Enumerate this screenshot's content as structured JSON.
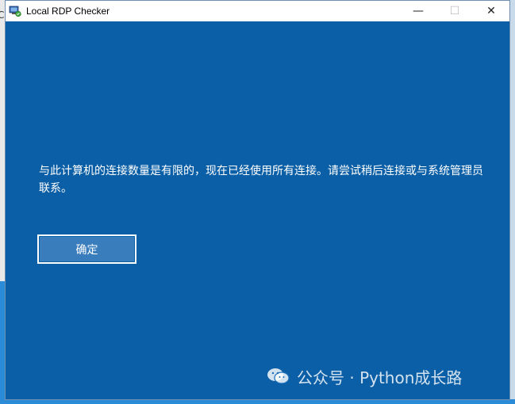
{
  "window": {
    "title": "Local RDP Checker",
    "minimize_glyph": "—",
    "maximize_glyph": "☐",
    "close_glyph": "✕"
  },
  "dialog": {
    "message": "与此计算机的连接数量是有限的，现在已经使用所有连接。请尝试稍后连接或与系统管理员联系。",
    "ok_label": "确定"
  },
  "watermark": {
    "text": "公众号 · Python成长路",
    "icon": "wechat-icon"
  },
  "colors": {
    "dialog_background": "#0b5fa6",
    "button_background": "#3a7dbc",
    "titlebar": "#ffffff"
  }
}
